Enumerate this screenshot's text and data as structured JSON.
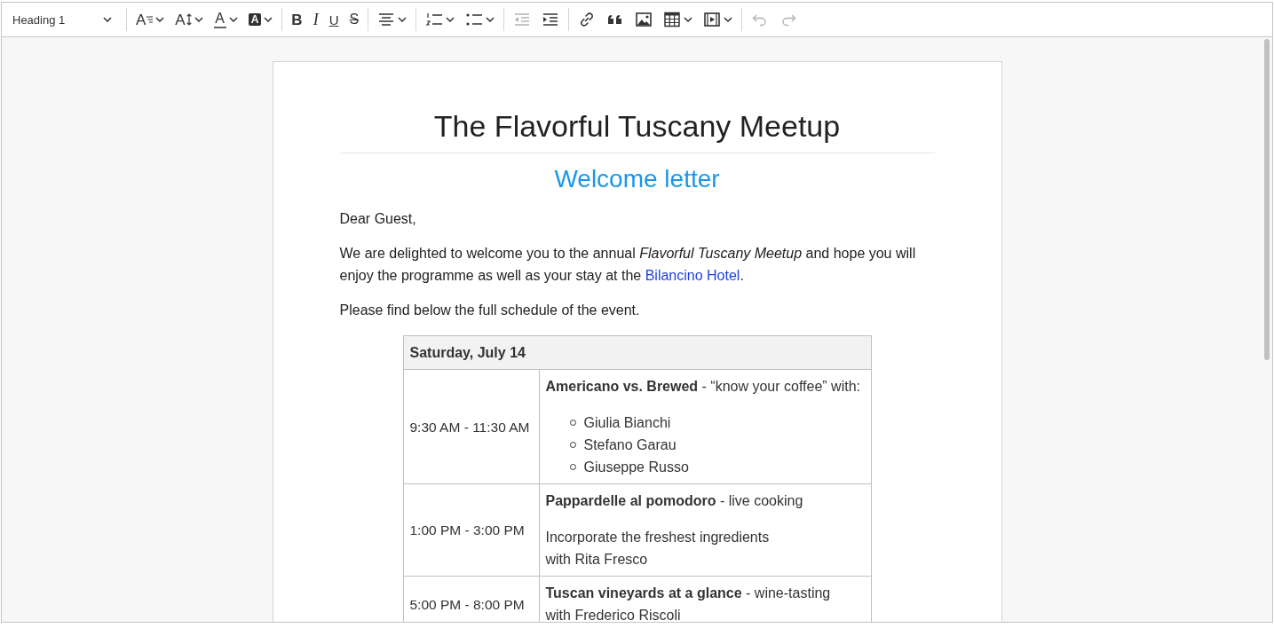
{
  "toolbar": {
    "heading_select": {
      "value": "Heading 1"
    },
    "groups": [
      [
        {
          "glyph": "A",
          "dropdown": true,
          "disabled": false
        },
        {
          "glyph": "A",
          "dropdown": true,
          "disabled": false
        },
        {
          "glyph": "A",
          "dropdown": true,
          "disabled": false
        },
        {
          "glyph": "A",
          "dropdown": true,
          "disabled": false
        }
      ],
      [
        {
          "glyph": "B",
          "dropdown": false,
          "disabled": false
        },
        {
          "glyph": "I",
          "dropdown": false,
          "disabled": false
        },
        {
          "glyph": "U",
          "dropdown": false,
          "disabled": false
        },
        {
          "glyph": "S",
          "dropdown": false,
          "disabled": false
        }
      ],
      [
        {
          "dropdown": true,
          "disabled": false
        }
      ],
      [
        {
          "dropdown": true,
          "disabled": false
        },
        {
          "dropdown": true,
          "disabled": false
        }
      ],
      [
        {
          "dropdown": false,
          "disabled": true
        },
        {
          "dropdown": false,
          "disabled": false
        }
      ],
      [
        {
          "dropdown": false,
          "disabled": false
        },
        {
          "dropdown": false,
          "disabled": false
        },
        {
          "dropdown": false,
          "disabled": false
        },
        {
          "dropdown": true,
          "disabled": false
        },
        {
          "dropdown": true,
          "disabled": false
        }
      ],
      [
        {
          "dropdown": false,
          "disabled": true
        },
        {
          "dropdown": false,
          "disabled": true
        }
      ]
    ]
  },
  "document": {
    "title": "The Flavorful Tuscany Meetup",
    "subtitle": "Welcome letter",
    "paragraphs": [
      {
        "text": "Dear Guest,"
      },
      {
        "text": "We are delighted to welcome you to the annual *Flavorful Tuscany Meetup* and hope you will enjoy the programme as well as your stay at the ",
        "link": "Bilancino Hotel",
        "after": "."
      },
      {
        "text": "Please find below the full schedule of the event."
      }
    ],
    "table": {
      "header": "Saturday, July 14",
      "rows": [
        {
          "time": "9:30 AM - 11:30 AM",
          "blocks": [
            {
              "kind": "paragraph",
              "lines": [
                "**Americano vs. Brewed** - “know your coffee” with:"
              ]
            },
            {
              "kind": "list",
              "items": [
                "Giulia Bianchi",
                "Stefano Garau",
                "Giuseppe Russo"
              ]
            }
          ]
        },
        {
          "time": "1:00 PM - 3:00 PM",
          "blocks": [
            {
              "kind": "paragraph",
              "lines": [
                "**Pappardelle al pomodoro** - live cooking"
              ]
            },
            {
              "kind": "paragraph",
              "lines": [
                "Incorporate the freshest ingredients",
                "with Rita Fresco"
              ]
            }
          ]
        },
        {
          "time": "5:00 PM - 8:00 PM",
          "blocks": [
            {
              "kind": "paragraph",
              "lines": [
                "**Tuscan vineyards at a glance** - wine-tasting",
                "with Frederico Riscoli"
              ]
            }
          ]
        }
      ]
    }
  }
}
